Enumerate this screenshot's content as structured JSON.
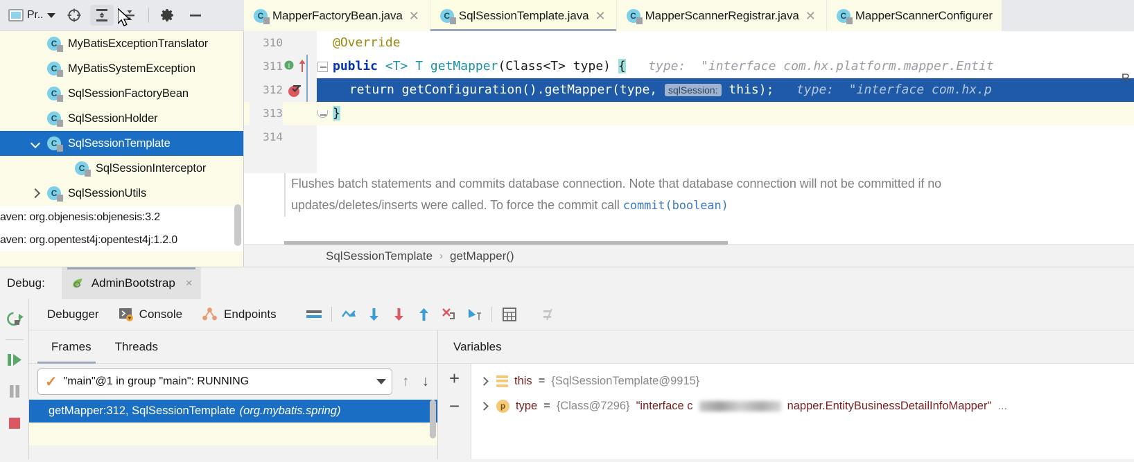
{
  "toolbar": {
    "project_label": "Pr..",
    "buttons": [
      {
        "name": "project-selector",
        "label": "Pr.."
      },
      {
        "name": "locate-icon",
        "label": "Locate"
      },
      {
        "name": "expand-all-icon",
        "label": "Expand All"
      },
      {
        "name": "collapse-all-icon",
        "label": "Collapse All"
      },
      {
        "name": "settings-gear-icon",
        "label": "Settings"
      },
      {
        "name": "hide-icon",
        "label": "Hide"
      }
    ]
  },
  "editor_tabs": [
    {
      "label": "MapperFactoryBean.java",
      "selected": false,
      "icon": "java-class-icon"
    },
    {
      "label": "SqlSessionTemplate.java",
      "selected": true,
      "icon": "java-class-icon"
    },
    {
      "label": "MapperScannerRegistrar.java",
      "selected": false,
      "icon": "java-class-icon"
    },
    {
      "label": "MapperScannerConfigurer",
      "selected": false,
      "icon": "java-class-icon"
    }
  ],
  "sidebar": {
    "tree": [
      {
        "label": "MyBatisExceptionTranslator",
        "indent": 2,
        "arrow": "none",
        "selected": false
      },
      {
        "label": "MyBatisSystemException",
        "indent": 2,
        "arrow": "none",
        "selected": false
      },
      {
        "label": "SqlSessionFactoryBean",
        "indent": 2,
        "arrow": "none",
        "selected": false
      },
      {
        "label": "SqlSessionHolder",
        "indent": 2,
        "arrow": "none",
        "selected": false
      },
      {
        "label": "SqlSessionTemplate",
        "indent": 1,
        "arrow": "down",
        "selected": true
      },
      {
        "label": "SqlSessionInterceptor",
        "indent": 3,
        "arrow": "none",
        "selected": false
      },
      {
        "label": "SqlSessionUtils",
        "indent": 1,
        "arrow": "right",
        "selected": false
      }
    ],
    "maven_entries": [
      "aven: org.objenesis:objenesis:3.2",
      "aven: org.opentest4j:opentest4j:1.2.0"
    ]
  },
  "editor": {
    "lines": [
      {
        "number": "310",
        "gutter": "none",
        "highlight": "none"
      },
      {
        "number": "311",
        "gutter": "impl-override",
        "highlight": "none"
      },
      {
        "number": "312",
        "gutter": "breakpoint-verified",
        "highlight": "execution"
      },
      {
        "number": "313",
        "gutter": "none",
        "highlight": "soft"
      },
      {
        "number": "314",
        "gutter": "none",
        "highlight": "none"
      }
    ],
    "code": {
      "line310": "@Override",
      "line311_a": "public ",
      "line311_b": "<T> T ",
      "line311_c": "getMapper",
      "line311_d": "(Class<T> type) ",
      "line311_brace": "{",
      "line311_hint": "type:  \"interface com.hx.platform.mapper.Entit",
      "line312_a": "return getConfiguration().getMapper(type, ",
      "line312_chip": "sqlSession:",
      "line312_b": " this);",
      "line312_hint": "type:  \"interface com.hx.p",
      "line313": "}"
    },
    "doc_text_1": "Flushes batch statements and commits database connection. Note that database",
    "doc_text_2": "connection will not be committed if no updates/deletes/inserts were called. To force the",
    "doc_text_3": "commit call ",
    "doc_link": "commit(boolean)",
    "right_marker": "R",
    "breadcrumb": [
      "SqlSessionTemplate",
      "getMapper()"
    ],
    "breadcrumb_sep": "›"
  },
  "debug_header": {
    "label": "Debug:",
    "config_name": "AdminBootstrap",
    "close": "×"
  },
  "debug_toolbar": {
    "tabs": [
      {
        "label": "Debugger",
        "icon": "none",
        "selected": true
      },
      {
        "label": "Console",
        "icon": "console-icon",
        "selected": false
      },
      {
        "label": "Endpoints",
        "icon": "endpoints-icon",
        "selected": false
      }
    ],
    "actions": [
      {
        "name": "layout-settings-icon"
      },
      {
        "name": "show-execution-point-icon"
      },
      {
        "name": "step-over-icon"
      },
      {
        "name": "step-into-icon"
      },
      {
        "name": "step-out-icon"
      },
      {
        "name": "force-step-into-icon"
      },
      {
        "name": "run-to-cursor-icon"
      },
      {
        "name": "evaluate-expression-icon"
      },
      {
        "name": "mute-breakpoints-icon"
      }
    ]
  },
  "run_rail": [
    {
      "name": "rerun-icon"
    },
    {
      "name": "resume-program-icon"
    },
    {
      "name": "pause-program-icon"
    },
    {
      "name": "stop-icon"
    }
  ],
  "frames": {
    "tabs": [
      {
        "label": "Frames",
        "selected": true
      },
      {
        "label": "Threads",
        "selected": false
      }
    ],
    "thread_value": "\"main\"@1 in group \"main\": RUNNING",
    "rows": [
      {
        "text": "getMapper:312, SqlSessionTemplate",
        "pkg": "(org.mybatis.spring)",
        "selected": true
      }
    ]
  },
  "variables": {
    "title": "Variables",
    "rows": [
      {
        "icon": "field-icon",
        "name": "this",
        "eq": " = ",
        "ref": "{SqlSessionTemplate@9915}",
        "value": "",
        "tail": ""
      },
      {
        "icon": "parameter-icon",
        "icon_letter": "p",
        "name": "type",
        "eq": " = ",
        "ref": "{Class@7296}",
        "value_prefix": "\"interface c",
        "value_suffix": "napper.EntityBusinessDetailInfoMapper\"",
        "tail": "..."
      }
    ],
    "add_button": "+",
    "remove_button": "−"
  },
  "colors": {
    "accent_blue": "#1a6fc4",
    "tab_yellow": "#fcfbe8",
    "keyword_blue": "#0033b3",
    "annotation_gold": "#9e880d",
    "type_cyan": "#1c8fa8",
    "breakpoint_red": "#db5860",
    "resume_green": "#59a869",
    "panel_gray": "#f2f2f2"
  }
}
